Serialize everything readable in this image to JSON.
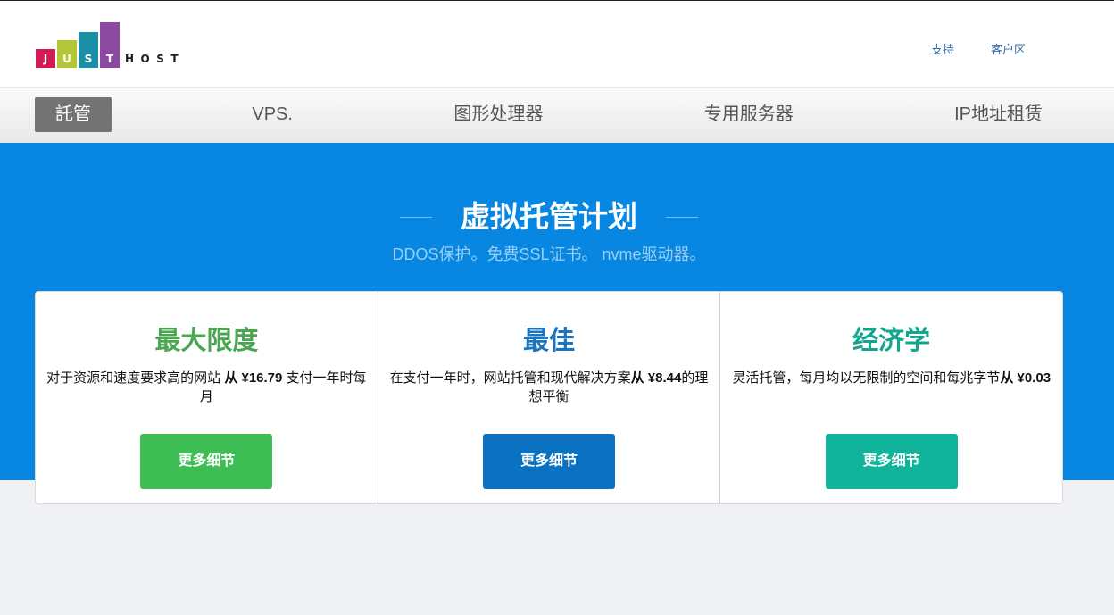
{
  "header": {
    "logo": {
      "letters": [
        {
          "char": "J",
          "color": "#d01c52"
        },
        {
          "char": "U",
          "color": "#b5c53a"
        },
        {
          "char": "S",
          "color": "#1b8fa6"
        },
        {
          "char": "T",
          "color": "#8b4aa0"
        }
      ],
      "suffix": "HOST"
    },
    "links": {
      "support": "支持",
      "client_area": "客户区"
    }
  },
  "nav": {
    "items": [
      {
        "label": "託管",
        "active": true
      },
      {
        "label": "VPS.",
        "active": false
      },
      {
        "label": "图形处理器",
        "active": false
      },
      {
        "label": "专用服务器",
        "active": false
      },
      {
        "label": "IP地址租赁",
        "active": false
      }
    ]
  },
  "hero": {
    "title": "虚拟托管计划",
    "subtitle": "DDOS保护。免费SSL证书。 nvme驱动器。",
    "background": "#0787e2"
  },
  "plans": [
    {
      "title": "最大限度",
      "desc_before": "对于资源和速度要求高的网站 ",
      "desc_price": "从 ¥16.79",
      "desc_after": " 支付一年时每月",
      "button": "更多细节",
      "title_color": "#4ba652",
      "button_color": "#3dbd54"
    },
    {
      "title": "最佳",
      "desc_before": "在支付一年时，网站托管和现代解决方案",
      "desc_price": "从 ¥8.44",
      "desc_after": "的理想平衡",
      "button": "更多细节",
      "title_color": "#1c75bc",
      "button_color": "#0a72c1"
    },
    {
      "title": "经济学",
      "desc_before": "灵活托管，每月均以无限制的空间和每兆字节",
      "desc_price": "从 ¥0.03",
      "button": "更多细节",
      "title_color": "#14a68c",
      "button_color": "#12b39b"
    }
  ]
}
